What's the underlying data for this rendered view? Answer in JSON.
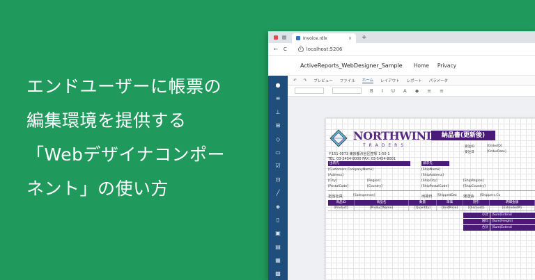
{
  "headline": {
    "lines": [
      "エンドユーザーに帳票の",
      "編集環境を提供する",
      "「Webデザイナコンポー",
      "ネント」の使い方"
    ]
  },
  "browser": {
    "tab_title": "Invoice.rdlx",
    "tab_close": "×",
    "new_tab": "+",
    "url": "localhost:5206",
    "nav": {
      "back": "←",
      "refresh": "C"
    },
    "app_brand": "ActiveReports_WebDesigner_Sample",
    "app_links": [
      "Home",
      "Privacy"
    ]
  },
  "designer": {
    "ribbon_tabs": [
      "プレビュー",
      "ファイル",
      "ホーム",
      "レイアウト",
      "レポート",
      "パラメータ"
    ],
    "selected_tab": "ホーム",
    "toolbar_glyphs": [
      "B",
      "I",
      "U"
    ]
  },
  "report": {
    "logo_word": "NORTHWIND",
    "logo_sub": "TRADERS",
    "title": "納品書(更新後)",
    "address_line1": "〒151-0073 東京都渋谷区笹塚 1-50-1",
    "address_line2": "TEL. 03-5454-8000  FAX. 03-5454-8001",
    "order_id_label": "受注ID",
    "order_id_value": "[OrderID]",
    "order_date_label": "受注日",
    "order_date_value": "[OrderDate]",
    "bill_to": "出荷先",
    "bill_fields": [
      "[Customers.CompanyName]",
      "[Address]",
      "[City]",
      "[Region]",
      "[PostalCode]",
      "[Country]"
    ],
    "ship_to": "請求先",
    "ship_fields": [
      "[ShipName]",
      "[ShipAddress]",
      "[ShipCity]",
      "[ShipRegion]",
      "[ShipPostalCode]",
      "[ShipCountry]"
    ],
    "sales_label": "担当社員",
    "sales_value": "[Salesperson]",
    "shipdate_label": "出荷日",
    "shipdate_value": "[ShippedDat",
    "shipper_label": "運送会",
    "shipper_value": "[Shippers.Co",
    "table_headers": [
      "商品ID",
      "商品名",
      "数量",
      "単価",
      "割引",
      "明細金額"
    ],
    "table_row": [
      "[Product]",
      "[ProductName]",
      "[Quantity]",
      "[UnitPrice]",
      "[Discount]",
      "[ExtendedPri"
    ],
    "sums": [
      {
        "label": "小計",
        "value": "[Sum(Extend"
      },
      {
        "label": "送料",
        "value": "[Sum(Freight)"
      },
      {
        "label": "合計",
        "value": "[Sum(Extend"
      }
    ]
  }
}
